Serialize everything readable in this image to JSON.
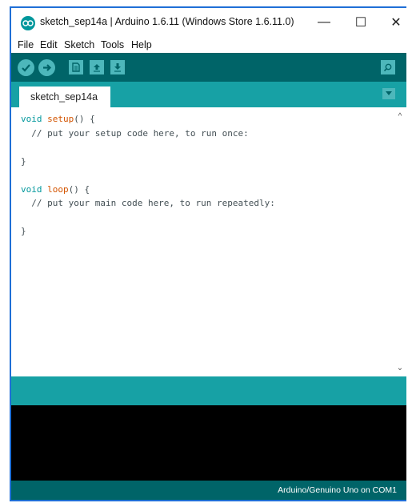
{
  "window": {
    "title": "sketch_sep14a | Arduino 1.6.11 (Windows Store 1.6.11.0)",
    "controls": {
      "minimize": "—",
      "maximize": "☐",
      "close": "✕"
    }
  },
  "menu": [
    "File",
    "Edit",
    "Sketch",
    "Tools",
    "Help"
  ],
  "toolbar": {
    "buttons": [
      "verify-icon",
      "upload-icon",
      "new-icon",
      "open-icon",
      "save-icon"
    ],
    "right_button": "serial-monitor-icon"
  },
  "tabs": [
    {
      "label": "sketch_sep14a"
    }
  ],
  "editor": {
    "lines": [
      "void setup() {",
      "  // put your setup code here, to run once:",
      "",
      "}",
      "",
      "void loop() {",
      "  // put your main code here, to run repeatedly:",
      "",
      "}"
    ]
  },
  "status": {
    "board": "Arduino/Genuino Uno on COM1"
  },
  "colors": {
    "toolbar": "#006468",
    "tabbar": "#17a1a5",
    "button": "#4db7bb",
    "console": "#000000",
    "keyword": "#00979c",
    "function": "#d35400"
  }
}
